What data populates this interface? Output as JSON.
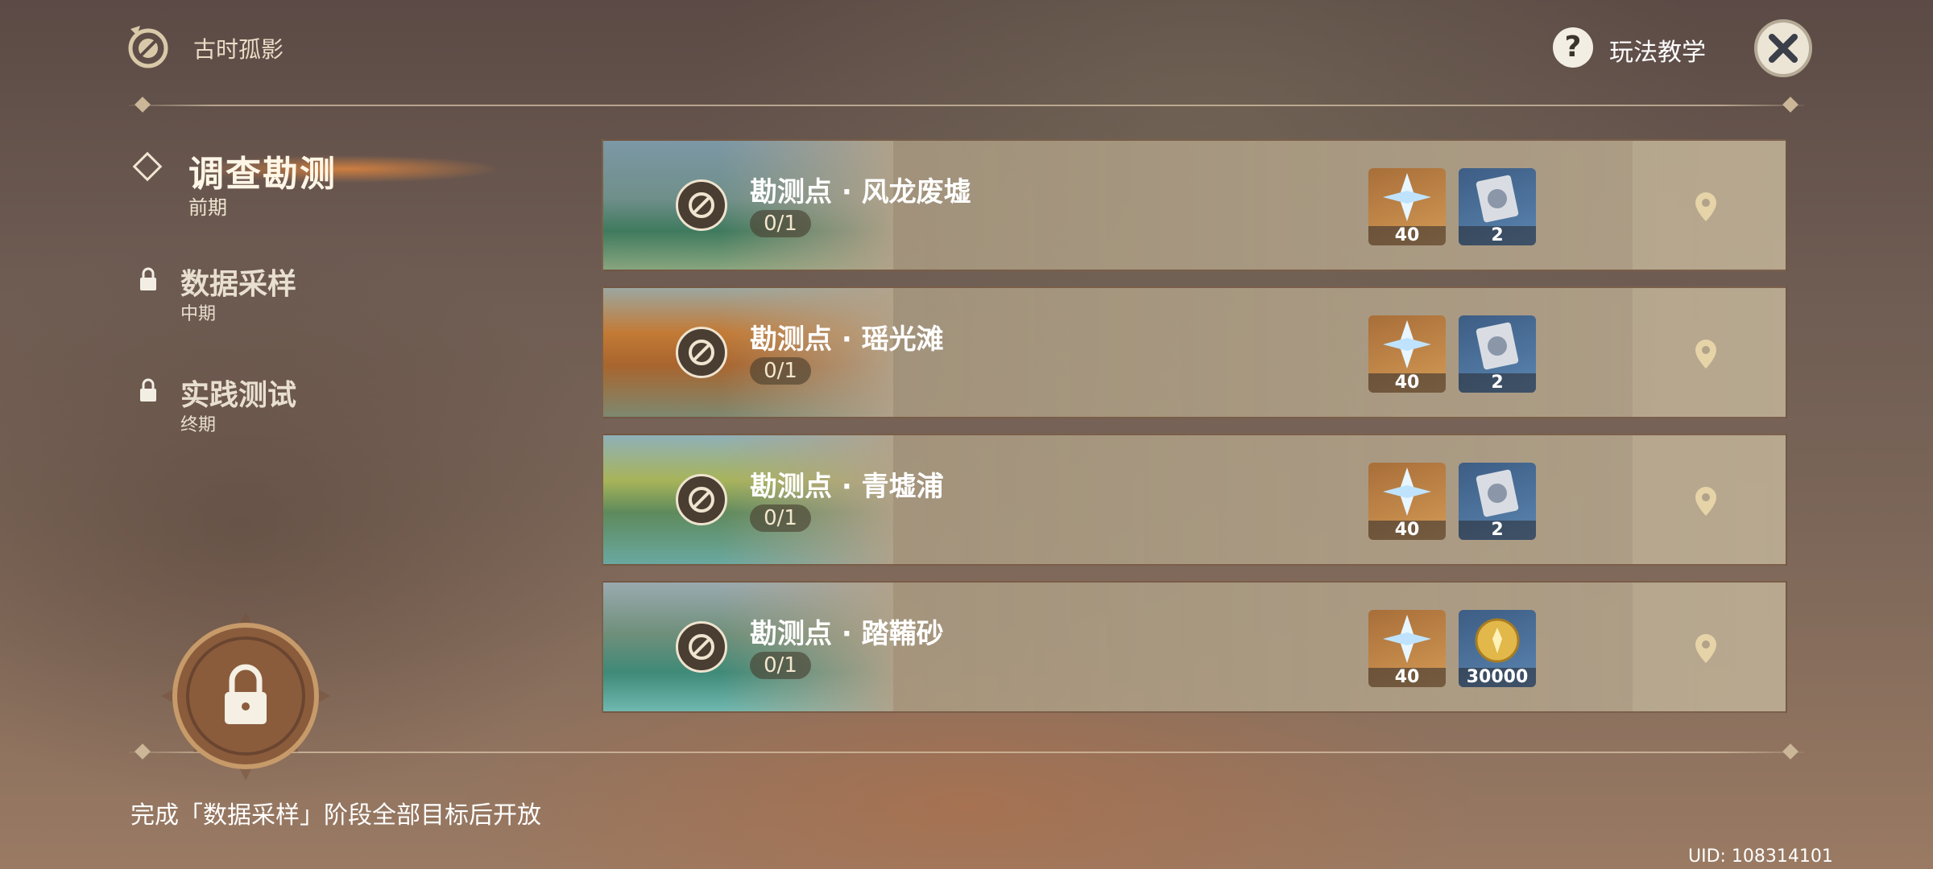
{
  "header": {
    "event_title": "古时孤影",
    "help_label": "玩法教学"
  },
  "nav": {
    "active": {
      "title": "调查勘测",
      "subtitle": "前期"
    },
    "items": [
      {
        "title": "数据采样",
        "subtitle": "中期",
        "locked": true
      },
      {
        "title": "实践测试",
        "subtitle": "终期",
        "locked": true
      }
    ]
  },
  "unlock_hint": "完成「数据采样」阶段全部目标后开放",
  "cards": [
    {
      "title": "勘测点 · 风龙废墟",
      "progress": "0/1",
      "rewards": [
        {
          "icon": "primogem-icon",
          "count": "40"
        },
        {
          "icon": "hero-wit-book-icon",
          "count": "2"
        }
      ]
    },
    {
      "title": "勘测点 · 瑶光滩",
      "progress": "0/1",
      "rewards": [
        {
          "icon": "primogem-icon",
          "count": "40"
        },
        {
          "icon": "hero-wit-book-icon",
          "count": "2"
        }
      ]
    },
    {
      "title": "勘测点 · 青墟浦",
      "progress": "0/1",
      "rewards": [
        {
          "icon": "primogem-icon",
          "count": "40"
        },
        {
          "icon": "hero-wit-book-icon",
          "count": "2"
        }
      ]
    },
    {
      "title": "勘测点 · 踏鞴砂",
      "progress": "0/1",
      "rewards": [
        {
          "icon": "primogem-icon",
          "count": "40"
        },
        {
          "icon": "mora-icon",
          "count": "30000"
        }
      ]
    }
  ],
  "uid": "UID: 108314101",
  "colors": {
    "accent_orange": "#f08c3c",
    "card_bg": "#b2a28a",
    "primogem_bg": "#d39a55",
    "book_bg": "#5a85b0"
  }
}
